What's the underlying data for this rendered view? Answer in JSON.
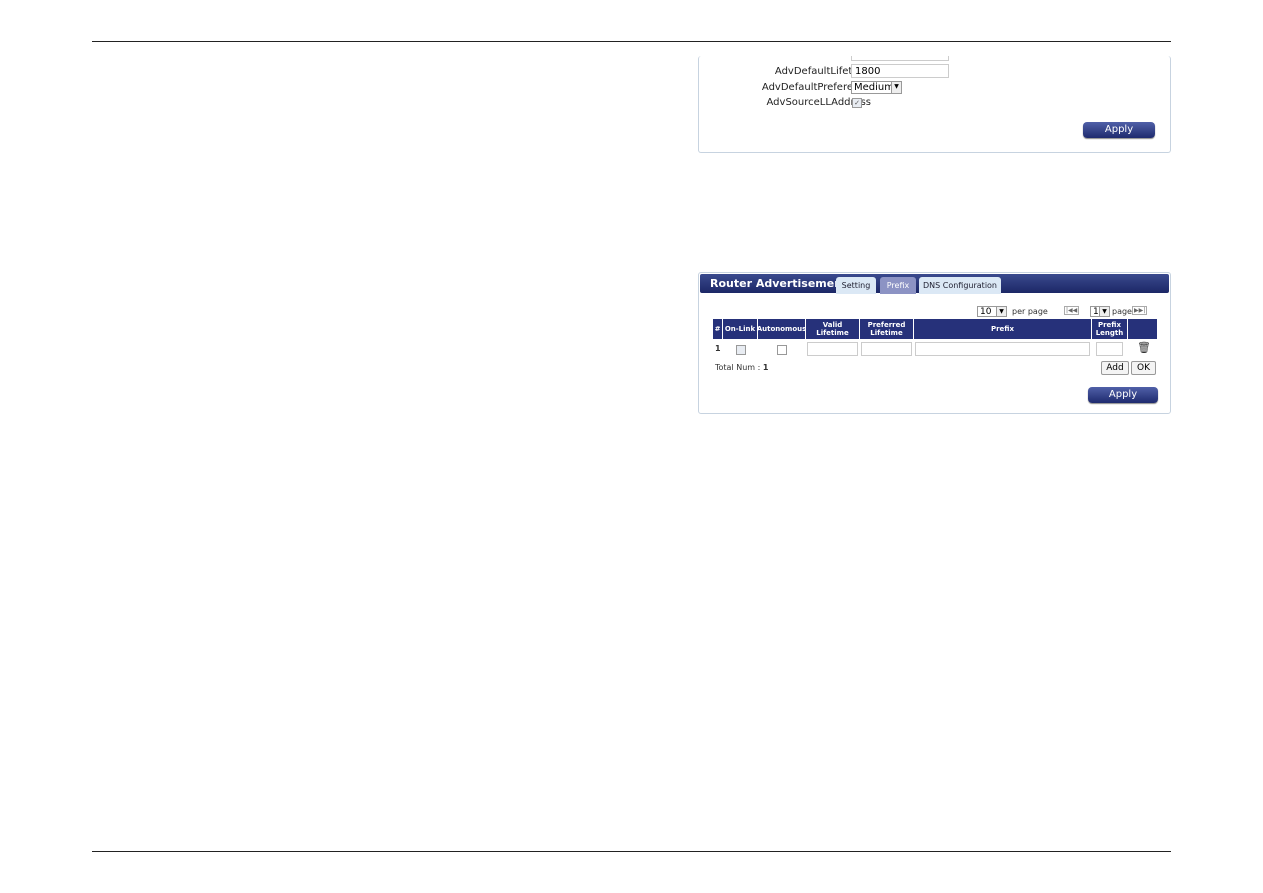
{
  "settings_panel": {
    "fields": [
      {
        "label": "AdvDefaultLifetime",
        "value": "1800"
      },
      {
        "label": "AdvDefaultPreference",
        "value": "Medium"
      },
      {
        "label": "AdvSourceLLAddress",
        "checked": true
      }
    ],
    "apply_label": "Apply"
  },
  "ra_panel": {
    "title": "Router Advertisement",
    "tabs": [
      {
        "label": "Setting"
      },
      {
        "label": "Prefix",
        "active": true
      },
      {
        "label": "DNS Configuration"
      }
    ],
    "per_page_value": "10",
    "per_page_label": "per page",
    "page_value": "1",
    "page_label": "page",
    "columns": [
      "#",
      "On-Link",
      "Autonomous",
      "Valid Lifetime",
      "Preferred Lifetime",
      "Prefix",
      "Prefix Length",
      ""
    ],
    "rows": [
      {
        "index": "1",
        "on_link": false,
        "autonomous": false,
        "valid_lifetime": "",
        "preferred_lifetime": "",
        "prefix": "",
        "prefix_length": ""
      }
    ],
    "total_label": "Total Num :",
    "total_value": "1",
    "add_label": "Add",
    "ok_label": "OK",
    "apply_label": "Apply"
  },
  "colors": {
    "header": "#26317a",
    "button": "#1e2a6e",
    "tab_active": "#8c93c4",
    "tab": "#dbe8f5"
  }
}
